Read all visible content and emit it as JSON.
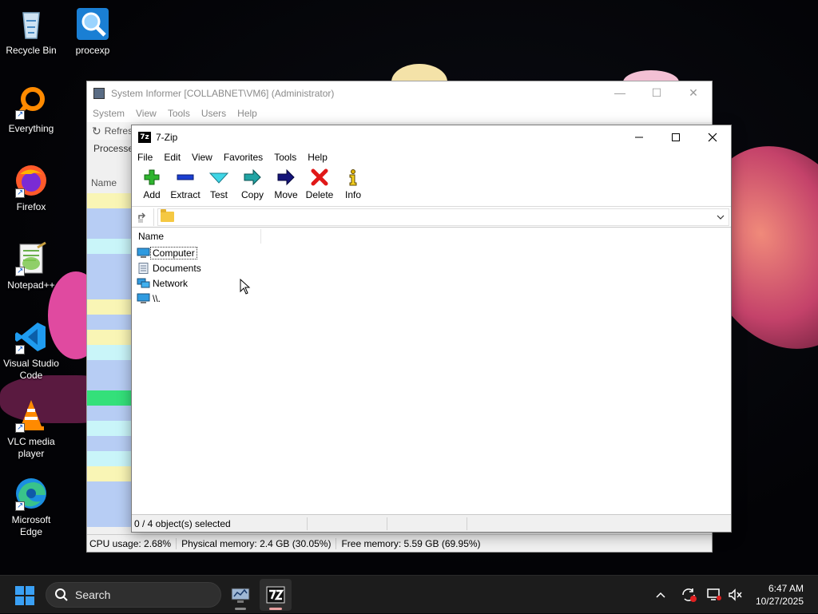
{
  "desktop": {
    "icons": [
      {
        "label": "Recycle Bin"
      },
      {
        "label": "procexp"
      },
      {
        "label": "Everything"
      },
      {
        "label": "Firefox"
      },
      {
        "label": "Notepad++"
      },
      {
        "label": "Visual Studio Code"
      },
      {
        "label": "VLC media player"
      },
      {
        "label": "Microsoft Edge"
      }
    ]
  },
  "system_informer": {
    "title": "System Informer [COLLABNET\\VM6] (Administrator)",
    "menu": [
      "System",
      "View",
      "Tools",
      "Users",
      "Help"
    ],
    "refresh_label": "Refresh",
    "tab_label": "Processes",
    "name_header": "Name",
    "status": {
      "cpu": "CPU usage: 2.68%",
      "physical": "Physical memory: 2.4 GB (30.05%)",
      "free": "Free memory: 5.59 GB (69.95%)"
    },
    "row_colors": [
      "#f9f5b5",
      "#b7cdf4",
      "#b7cdf4",
      "#c9f5f9",
      "#b7cdf4",
      "#b7cdf4",
      "#b7cdf4",
      "#f9f5b5",
      "#b7cdf4",
      "#f9f5b5",
      "#c9f5f9",
      "#b7cdf4",
      "#b7cdf4",
      "#34e07a",
      "#b7cdf4",
      "#c9f5f9",
      "#b7cdf4",
      "#c9f5f9",
      "#f9f5b5",
      "#b7cdf4",
      "#b7cdf4",
      "#b7cdf4"
    ]
  },
  "zip": {
    "title": "7-Zip",
    "app_icon_text": "7z",
    "menu": [
      "File",
      "Edit",
      "View",
      "Favorites",
      "Tools",
      "Help"
    ],
    "toolbar": [
      {
        "label": "Add",
        "icon": "add-icon"
      },
      {
        "label": "Extract",
        "icon": "extract-icon"
      },
      {
        "label": "Test",
        "icon": "test-icon"
      },
      {
        "label": "Copy",
        "icon": "copy-icon"
      },
      {
        "label": "Move",
        "icon": "move-icon"
      },
      {
        "label": "Delete",
        "icon": "delete-icon"
      },
      {
        "label": "Info",
        "icon": "info-icon"
      }
    ],
    "address_value": "",
    "column_name": "Name",
    "items": [
      {
        "label": "Computer",
        "icon": "computer-icon"
      },
      {
        "label": "Documents",
        "icon": "documents-icon"
      },
      {
        "label": "Network",
        "icon": "network-icon"
      },
      {
        "label": "\\\\.",
        "icon": "device-icon"
      }
    ],
    "status_text": "0 / 4 object(s) selected"
  },
  "taskbar": {
    "search_placeholder": "Search",
    "time": "6:47 AM",
    "date": "10/27/2025"
  }
}
